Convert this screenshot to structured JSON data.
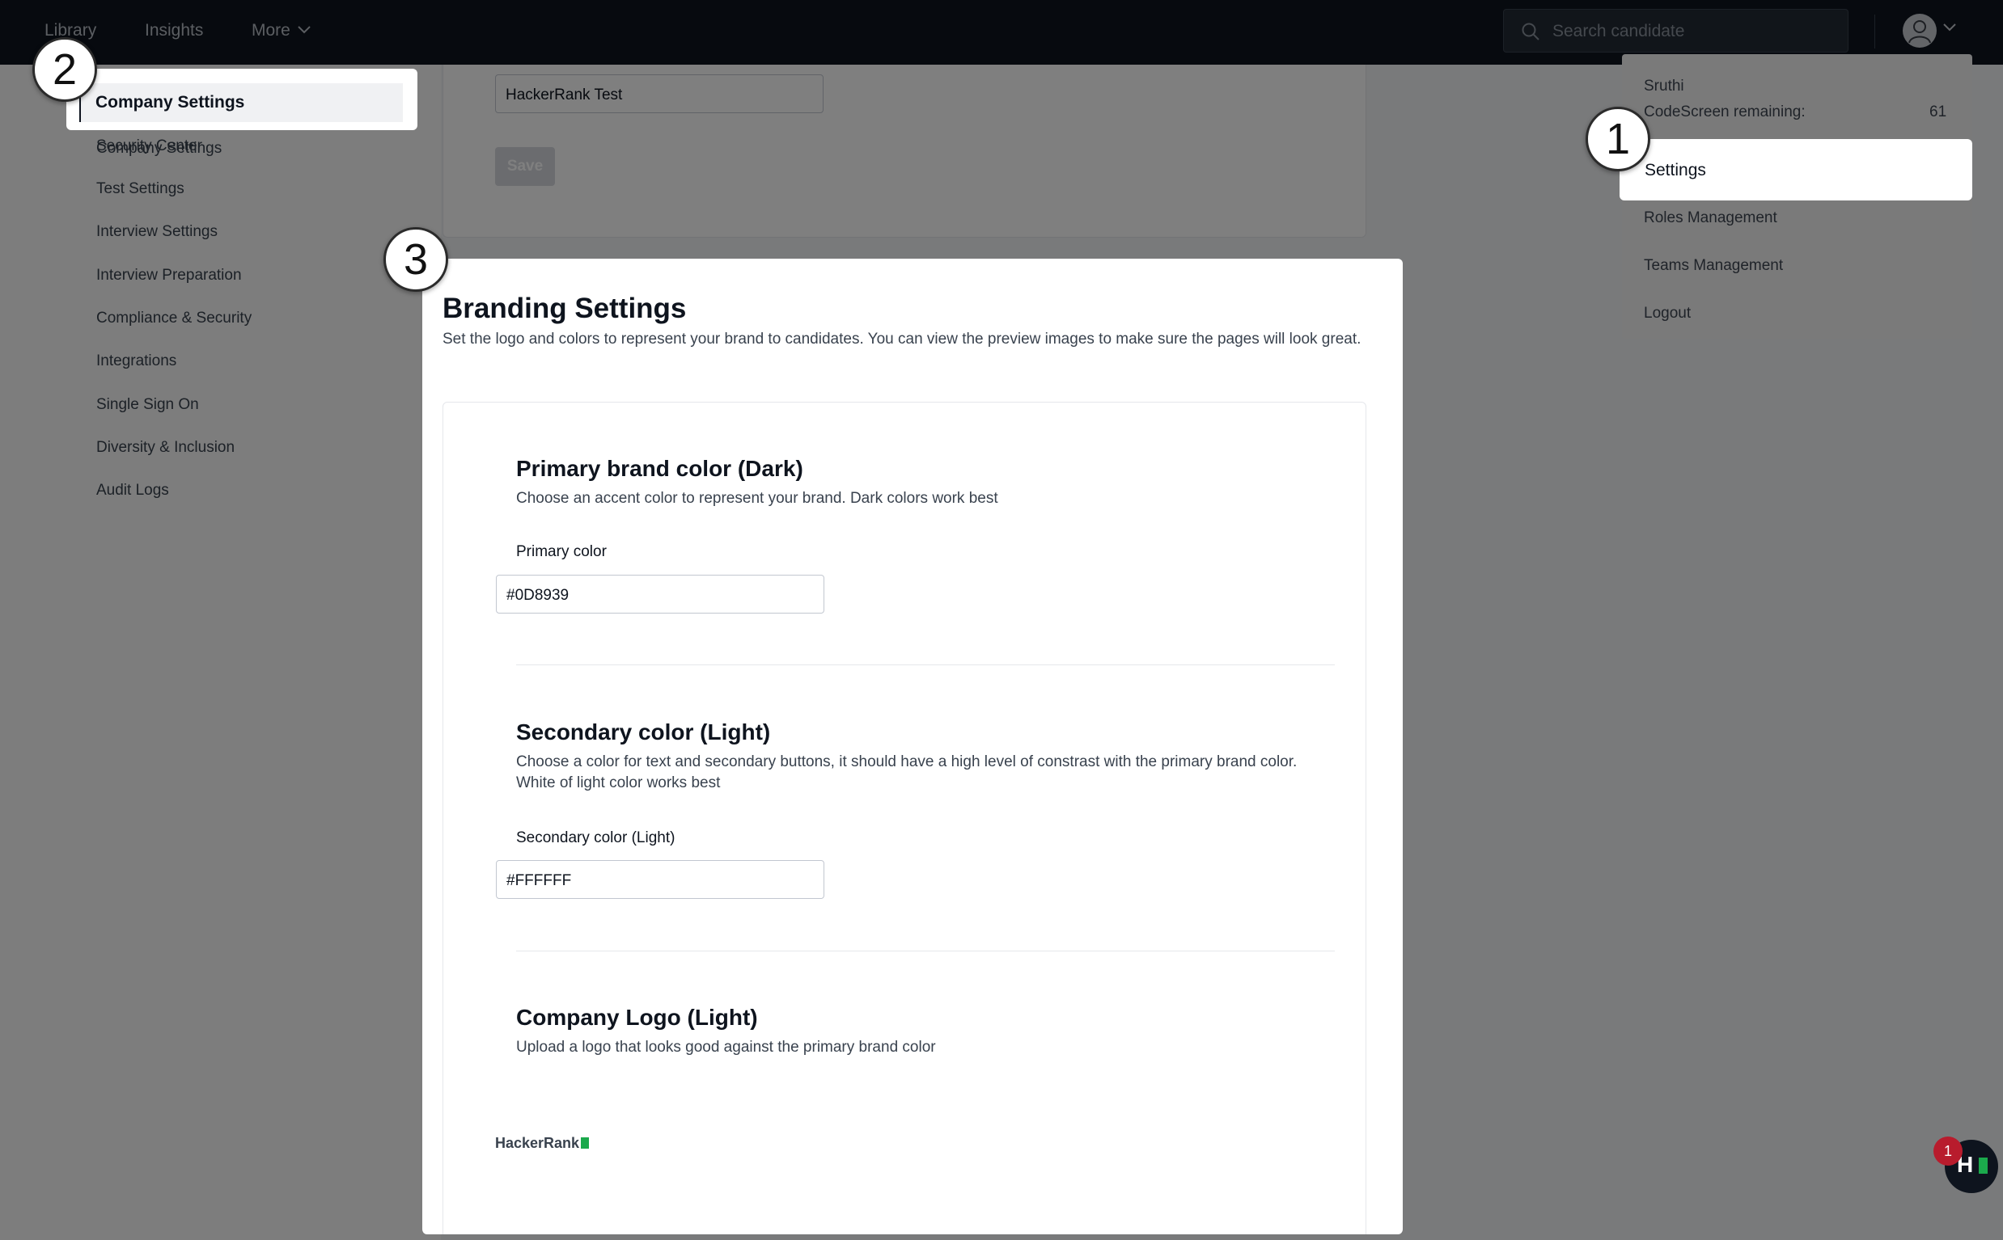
{
  "topbar": {
    "nav": [
      "Library",
      "Insights",
      "More"
    ],
    "search_placeholder": "Search candidate"
  },
  "sidebar": {
    "items": [
      "Company Settings",
      "Security Center",
      "Test Settings",
      "Interview Settings",
      "Interview Preparation",
      "Compliance & Security",
      "Integrations",
      "Single Sign On",
      "Diversity & Inclusion",
      "Audit Logs"
    ]
  },
  "company_form": {
    "name_value": "HackerRank Test",
    "save_label": "Save"
  },
  "branding": {
    "title": "Branding Settings",
    "subtitle": "Set the logo and colors to represent your brand to candidates. You can view the preview images to make sure the pages will look great.",
    "primary": {
      "title": "Primary brand color (Dark)",
      "desc": "Choose an accent color to represent your brand. Dark colors work best",
      "label": "Primary color",
      "value": "#0D8939"
    },
    "secondary": {
      "title": "Secondary color (Light)",
      "desc_1": "Choose a color for text and secondary buttons, it should have a high level of constrast with the primary brand color.",
      "desc_2": "White of light color works best",
      "label": "Secondary color (Light)",
      "value": "#FFFFFF"
    },
    "logo": {
      "title": "Company Logo (Light)",
      "desc": "Upload a logo that looks good against the primary brand color",
      "preview_text": "HackerRank"
    }
  },
  "user_menu": {
    "user_name": "Sruthi",
    "codescreen_label": "CodeScreen remaining:",
    "codescreen_value": "61",
    "items": [
      "Settings",
      "Roles Management",
      "Teams Management",
      "Logout"
    ]
  },
  "steps": [
    "1",
    "2",
    "3"
  ],
  "help": {
    "notification_count": "1",
    "logo_letter": "H"
  },
  "colors": {
    "topbar": "#0e141e",
    "brand_green": "#1ba94c",
    "badge_red": "#b81c2d"
  }
}
